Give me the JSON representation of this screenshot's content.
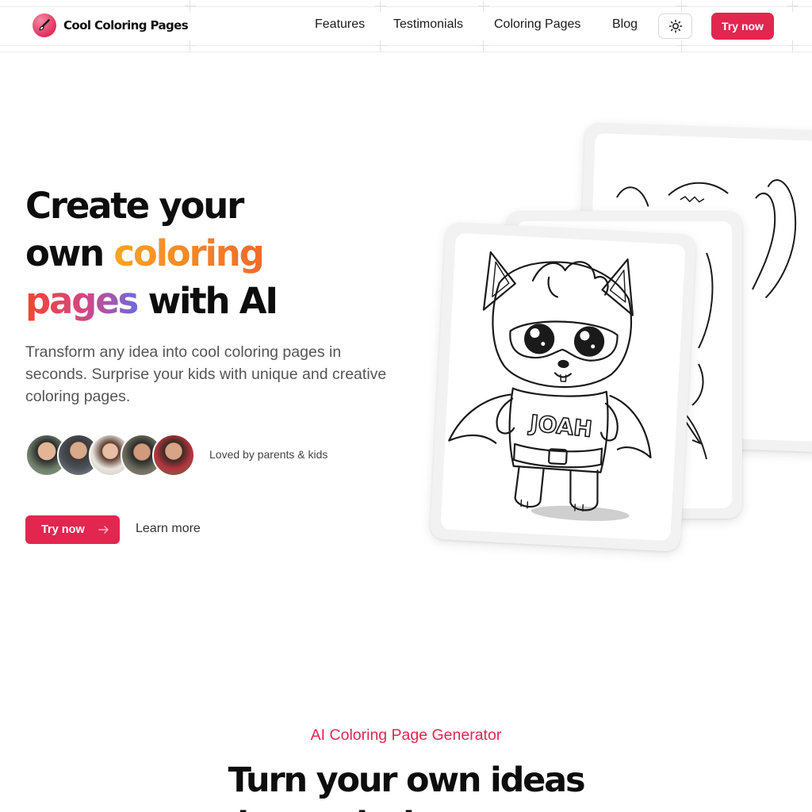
{
  "brand": {
    "name": "Cool Coloring Pages",
    "logo_icon": "paintbrush-icon",
    "accent_color": "#e2264f"
  },
  "nav": {
    "items": [
      "Features",
      "Testimonials",
      "Coloring Pages",
      "Blog"
    ],
    "theme_icon": "sun-icon",
    "cta": "Try now"
  },
  "hero": {
    "title_parts": {
      "p1": "Create your",
      "p2": "own ",
      "p3": "coloring",
      "p4": "pages",
      "p5": " with AI"
    },
    "subtitle": "Transform any idea into cool coloring pages in seconds. Surprise your kids with unique and creative coloring pages.",
    "social_proof": "Loved by parents & kids",
    "avatar_count": 5,
    "cta_primary": "Try now",
    "cta_primary_icon": "arrow-right-icon",
    "cta_secondary": "Learn more"
  },
  "showcase": {
    "front_card_text": "JOAH"
  },
  "section": {
    "eyebrow": "AI Coloring Page Generator",
    "title_line1": "Turn your own ideas",
    "title_line2": "into coloring pages"
  }
}
